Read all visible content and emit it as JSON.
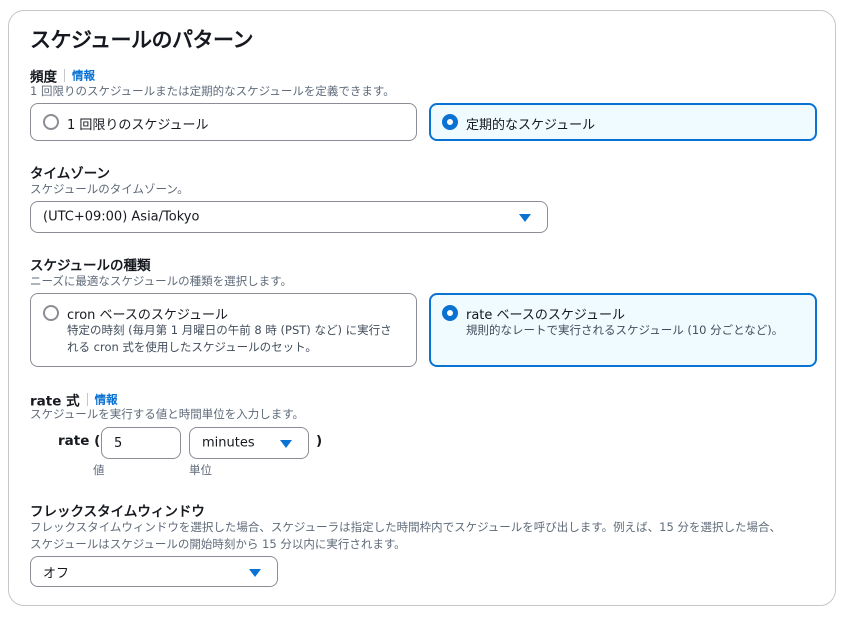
{
  "title": "スケジュールのパターン",
  "frequency": {
    "label": "頻度",
    "info": "情報",
    "description": "1 回限りのスケジュールまたは定期的なスケジュールを定義できます。",
    "options": [
      {
        "label": "1 回限りのスケジュール",
        "selected": false
      },
      {
        "label": "定期的なスケジュール",
        "selected": true
      }
    ]
  },
  "timezone": {
    "label": "タイムゾーン",
    "description": "スケジュールのタイムゾーン。",
    "value": "(UTC+09:00) Asia/Tokyo"
  },
  "schedule_type": {
    "label": "スケジュールの種類",
    "description": "ニーズに最適なスケジュールの種類を選択します。",
    "options": [
      {
        "label": "cron ベースのスケジュール",
        "description": "特定の時刻 (毎月第 1 月曜日の午前 8 時 (PST) など) に実行される cron 式を使用したスケジュールのセット。",
        "selected": false
      },
      {
        "label": "rate ベースのスケジュール",
        "description": "規則的なレートで実行されるスケジュール (10 分ごとなど)。",
        "selected": true
      }
    ]
  },
  "rate": {
    "label": "rate 式",
    "info": "情報",
    "description": "スケジュールを実行する値と時間単位を入力します。",
    "prefix": "rate (",
    "suffix": ")",
    "value": "5",
    "value_caption": "値",
    "unit": "minutes",
    "unit_caption": "単位"
  },
  "flex": {
    "label": "フレックスタイムウィンドウ",
    "description_line1": "フレックスタイムウィンドウを選択した場合、スケジューラは指定した時間枠内でスケジュールを呼び出します。例えば、15 分を選択した場合、",
    "description_line2": "スケジュールはスケジュールの開始時刻から 15 分以内に実行されます。",
    "value": "オフ"
  },
  "colors": {
    "accent": "#0972d3",
    "selected_bg": "#f0fbff",
    "border": "#8c8c94"
  }
}
